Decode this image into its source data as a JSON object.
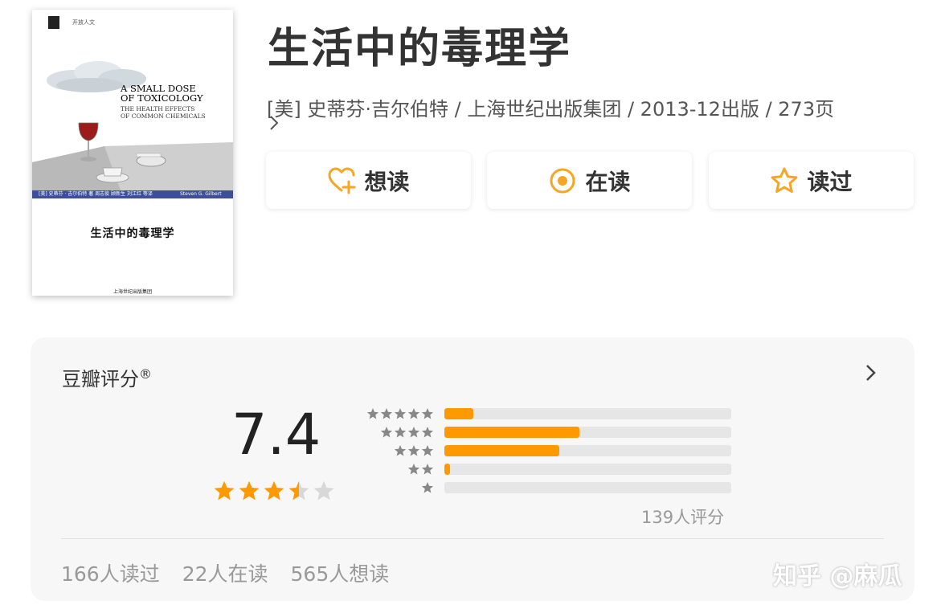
{
  "cover": {
    "series": "开放人文",
    "english_title_1": "A SMALL DOSE",
    "english_title_2": "OF TOXICOLOGY",
    "english_subtitle_1": "THE HEALTH EFFECTS",
    "english_subtitle_2": "OF COMMON CHEMICALS",
    "band_text": "[美] 史蒂芬 · 吉尔伯特 著  周志俊 顾新生 刘江红 等译",
    "author_en": "Steven G. Gilbert",
    "chinese_title": "生活中的毒理学",
    "publisher": "上海世纪出版集团"
  },
  "book": {
    "title": "生活中的毒理学",
    "meta": "[美] 史蒂芬·吉尔伯特 / 上海世纪出版集团 / 2013-12出版 / 273页"
  },
  "actions": {
    "want": "想读",
    "reading": "在读",
    "read": "读过"
  },
  "rating": {
    "title": "豆瓣评分",
    "reg_mark": "®",
    "score": "7.4",
    "stars_filled": 3.5,
    "distribution": [
      {
        "stars": 5,
        "fraction": 0.1
      },
      {
        "stars": 4,
        "fraction": 0.47
      },
      {
        "stars": 3,
        "fraction": 0.4
      },
      {
        "stars": 2,
        "fraction": 0.02
      },
      {
        "stars": 1,
        "fraction": 0.0
      }
    ],
    "count": "139人评分"
  },
  "stats": {
    "read": "166人读过",
    "reading": "22人在读",
    "want": "565人想读"
  },
  "watermark": "知乎 @麻瓜",
  "colors": {
    "accent": "#ff9900",
    "cover_band": "#3d4f9c",
    "star_empty": "#d8d8d8",
    "dist_star": "#888888"
  },
  "icons": {
    "want": "heart-plus-icon",
    "reading": "target-icon",
    "read": "star-outline-icon"
  }
}
